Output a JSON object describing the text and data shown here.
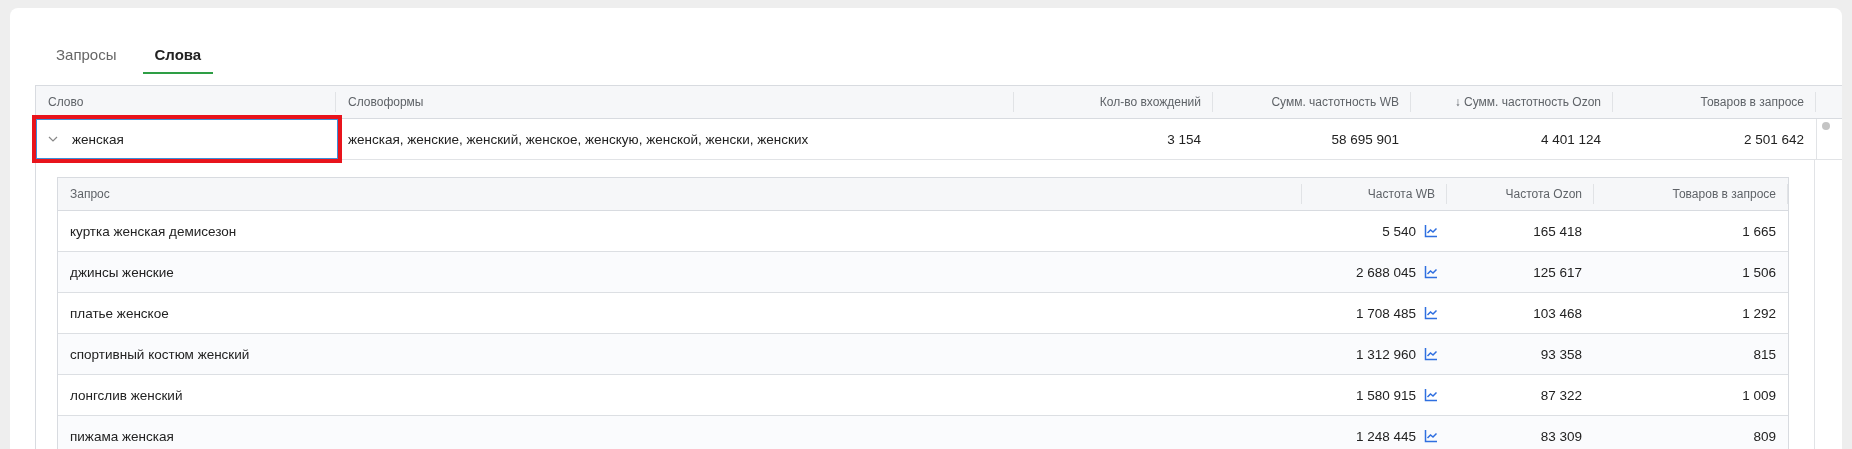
{
  "tabs": [
    {
      "label": "Запросы",
      "selected": false
    },
    {
      "label": "Слова",
      "selected": true
    }
  ],
  "words_table": {
    "columns": [
      "Слово",
      "Словоформы",
      "Кол-во вхождений",
      "Сумм. частотность WB",
      "↓ Сумм. частотность Ozon",
      "Товаров в запросе"
    ],
    "rows": [
      {
        "word": "женская",
        "expanded": true,
        "forms": "женская, женские, женский, женское, женскую, женской, женски, женских",
        "occurrences": "3 154",
        "wb": "58 695 901",
        "ozon": "4 401 124",
        "products": "2 501 642",
        "queries": {
          "columns": [
            "Запрос",
            "Частота WB",
            "Частота Ozon",
            "Товаров в запросе"
          ],
          "rows": [
            {
              "query": "куртка женская демисезон",
              "wb": "5 540",
              "ozon": "165 418",
              "products": "1 665"
            },
            {
              "query": "джинсы женские",
              "wb": "2 688 045",
              "ozon": "125 617",
              "products": "1 506"
            },
            {
              "query": "платье женское",
              "wb": "1 708 485",
              "ozon": "103 468",
              "products": "1 292"
            },
            {
              "query": "спортивный костюм женский",
              "wb": "1 312 960",
              "ozon": "93 358",
              "products": "815"
            },
            {
              "query": "лонгслив женский",
              "wb": "1 580 915",
              "ozon": "87 322",
              "products": "1 009"
            },
            {
              "query": "пижама женская",
              "wb": "1 248 445",
              "ozon": "83 309",
              "products": "809"
            }
          ]
        }
      }
    ]
  }
}
